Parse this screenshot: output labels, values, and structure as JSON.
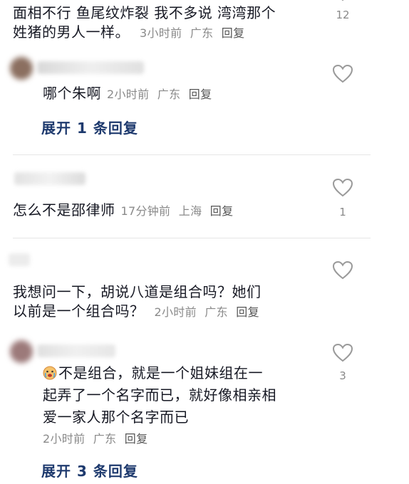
{
  "comments": [
    {
      "text_lines": [
        "面相不行 鱼尾纹炸裂 我不多说 湾湾那个",
        "姓猪的男人一样。"
      ],
      "time": "3小时前",
      "location": "广东",
      "reply_label": "回复",
      "like_count": "12"
    },
    {
      "text": "哪个朱啊",
      "time": "2小时前",
      "location": "广东",
      "reply_label": "回复",
      "expand_label": "展开 1 条回复"
    },
    {
      "text": "怎么不是邵律师",
      "time": "17分钟前",
      "location": "上海",
      "reply_label": "回复",
      "like_count": "1"
    },
    {
      "text_lines": [
        "我想问一下，胡说八道是组合吗？她们",
        "以前是一个组合吗？"
      ],
      "time": "2小时前",
      "location": "广东",
      "reply_label": "回复"
    },
    {
      "text_lines": [
        "不是组合，就是一个姐妹组在一",
        "起弄了一个名字而已，就好像相亲相",
        "爱一家人那个名字而已"
      ],
      "time": "2小时前",
      "location": "广东",
      "reply_label": "回复",
      "like_count": "3",
      "expand_label": "展开 3 条回复"
    }
  ],
  "icons": {
    "like": "heart-outline-icon",
    "emoji": "crying-face-emoji"
  },
  "colors": {
    "expand_link": "#1e3a6e",
    "meta_text": "#8a8a8a",
    "heart_stroke": "#9a9a9a"
  }
}
